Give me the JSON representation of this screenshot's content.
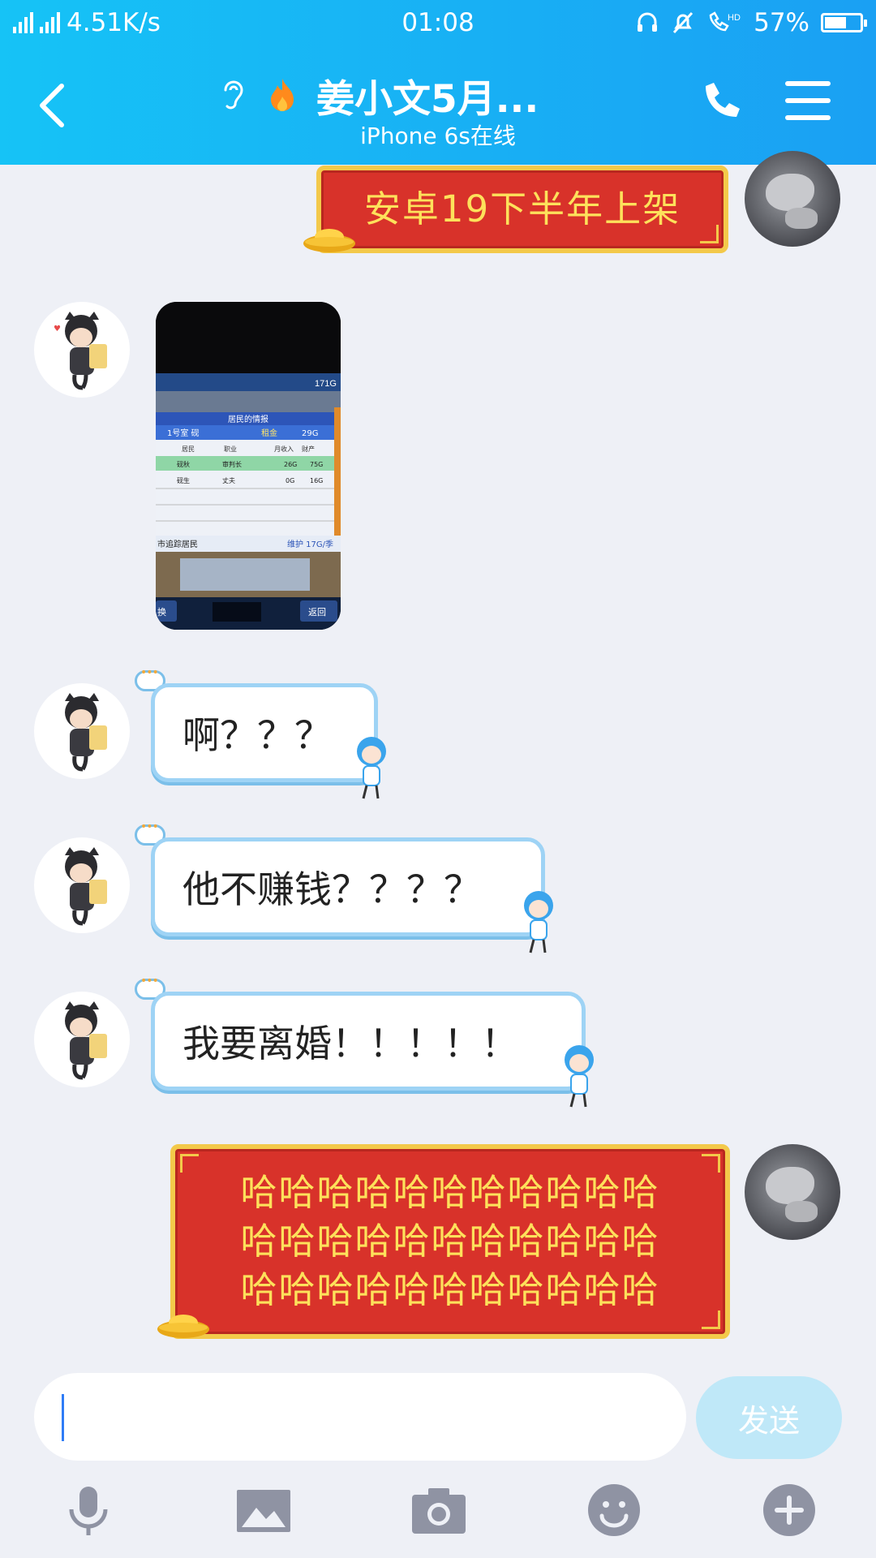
{
  "status_bar": {
    "network_left": "3G",
    "network_right": "4G 4G",
    "speed": "4.51K/s",
    "time": "01:08",
    "hd_label": "HD",
    "battery": "57%",
    "battery_level": 0.57
  },
  "header": {
    "title": "姜小文5月...",
    "subtitle": "iPhone 6s在线"
  },
  "messages": [
    {
      "side": "right",
      "type": "red-bubble",
      "text": "安卓19下半年上架"
    },
    {
      "side": "left",
      "type": "image"
    },
    {
      "side": "left",
      "type": "text",
      "text": "啊？？？"
    },
    {
      "side": "left",
      "type": "text",
      "text": "他不赚钱？？？？"
    },
    {
      "side": "left",
      "type": "text",
      "text": "我要离婚！！！！！"
    },
    {
      "side": "right",
      "type": "red-bubble",
      "lines": [
        "哈哈哈哈哈哈哈哈哈哈哈",
        "哈哈哈哈哈哈哈哈哈哈哈",
        "哈哈哈哈哈哈哈哈哈哈哈"
      ]
    }
  ],
  "screenshot_msg": {
    "count_top": "171G",
    "header_text": "居民的情报",
    "room": "1号室 砚",
    "rent_label": "租金",
    "rent_value": "29G",
    "col_resident": "居民",
    "col_job": "职业",
    "col_income": "月收入",
    "col_property": "财产",
    "row1": [
      "砚秋",
      "审判长",
      "26G",
      "75G"
    ],
    "row2": [
      "砚生",
      "丈夫",
      "0G",
      "16G"
    ],
    "track_label": "市追踪居民",
    "maintenance": "维护 17G/季",
    "left_btn": "换",
    "back_btn": "返回"
  },
  "input": {
    "placeholder": "",
    "send_label": "发送"
  },
  "toolbar": [
    "mic-icon",
    "image-icon",
    "camera-icon",
    "emoji-icon",
    "plus-icon"
  ],
  "colors": {
    "header_start": "#16c3f6",
    "header_end": "#1aa0f3",
    "red_bubble": "#d8322a",
    "gold": "#f3c94a",
    "text_gold": "#fde15b",
    "send_bg": "#bfe8f8",
    "bg": "#eef0f6"
  }
}
